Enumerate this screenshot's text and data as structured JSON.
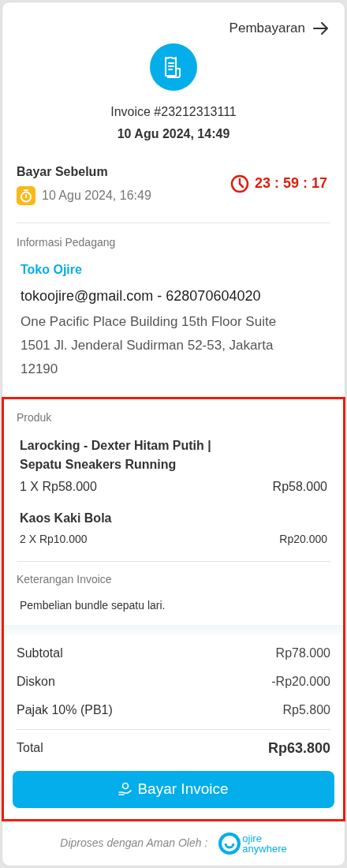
{
  "header": {
    "link": "Pembayaran"
  },
  "invoice": {
    "number": "Invoice #23212313111",
    "date": "10 Agu 2024, 14:49"
  },
  "deadline": {
    "label": "Bayar Sebelum",
    "date": "10 Agu 2024, 16:49",
    "countdown": "23 : 59 : 17"
  },
  "merchant": {
    "section": "Informasi Pedagang",
    "name": "Toko Ojire",
    "contact": "tokoojire@gmail.com - 628070604020",
    "address": "One Pacific Place Building 15th Floor Suite 1501 Jl. Jenderal Sudirman 52-53, Jakarta 12190"
  },
  "products": {
    "section": "Produk",
    "items": [
      {
        "name": "Larocking - Dexter Hitam Putih | Sepatu Sneakers Running",
        "qty_price": "1 X Rp58.000",
        "total": "Rp58.000",
        "large": true
      },
      {
        "name": "Kaos Kaki Bola",
        "qty_price": "2 X Rp10.000",
        "total": "Rp20.000",
        "large": false
      }
    ]
  },
  "note": {
    "section": "Keterangan Invoice",
    "text": "Pembelian bundle sepatu lari."
  },
  "summary": [
    {
      "label": "Subtotal",
      "value": "Rp78.000"
    },
    {
      "label": "Diskon",
      "value": "-Rp20.000"
    },
    {
      "label": "Pajak 10% (PB1)",
      "value": "Rp5.800"
    }
  ],
  "total": {
    "label": "Total",
    "value": "Rp63.800"
  },
  "pay_button": "Bayar Invoice",
  "footer": {
    "text": "Diproses dengan Aman Oleh :",
    "logo_top": "ojire",
    "logo_bottom": "anywhere"
  }
}
